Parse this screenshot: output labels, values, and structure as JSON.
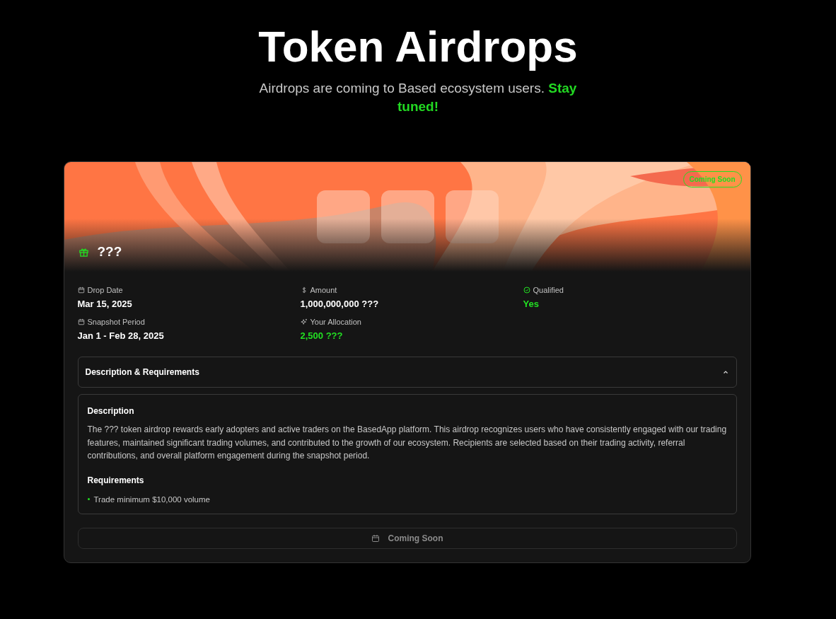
{
  "page": {
    "title": "Token Airdrops",
    "subtitle": "Airdrops are coming to Based ecosystem users.",
    "subtitle_accent": "Stay tuned!"
  },
  "airdrop": {
    "badge": "Coming Soon",
    "name": "???",
    "stats": [
      {
        "label": "Drop Date",
        "value": "Mar 15, 2025",
        "kind": "calendar",
        "accent": false
      },
      {
        "label": "Amount",
        "value": "1,000,000,000 ???",
        "kind": "dollar",
        "accent": false
      },
      {
        "label": "Qualified",
        "value": "Yes",
        "kind": "check",
        "accent": true
      },
      {
        "label": "Snapshot Period",
        "value": "Jan 1 - Feb 28, 2025",
        "kind": "calendar",
        "accent": false
      },
      {
        "label": "Your Allocation",
        "value": "2,500 ???",
        "kind": "sparkle",
        "accent": true
      }
    ],
    "details": {
      "title": "Description & Requirements",
      "expanded": true,
      "description_heading": "Description",
      "description": "The ??? token airdrop rewards early adopters and active traders on the BasedApp platform. This airdrop recognizes users who have consistently engaged with our trading features, maintained significant trading volumes, and contributed to the growth of our ecosystem. Recipients are selected based on their trading activity, referral contributions, and overall platform engagement during the snapshot period.",
      "requirements_heading": "Requirements",
      "requirements": [
        "Trade minimum $10,000 volume"
      ]
    },
    "action": {
      "label": "Coming Soon",
      "disabled": true
    }
  }
}
